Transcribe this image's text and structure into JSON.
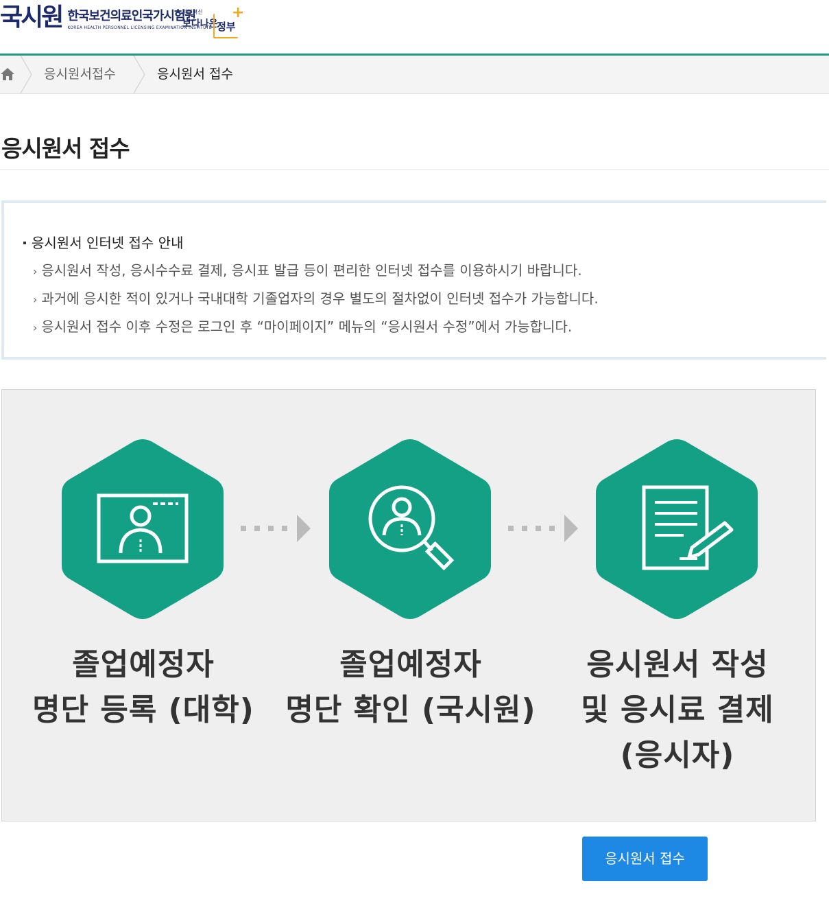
{
  "header": {
    "logo_mark": "국시원",
    "logo_name_ko": "한국보건의료인국가시험원",
    "logo_name_en": "KOREA HEALTH PERSONNEL LICENSING EXAMINATION INSTITUTE",
    "gov_small": "정부혁신",
    "gov_big": "보다나은",
    "gov_word": "정부"
  },
  "breadcrumb": {
    "items": [
      "응시원서접수",
      "응시원서 접수"
    ]
  },
  "page_title": "응시원서 접수",
  "notice": {
    "heading": "응시원서 인터넷 접수 안내",
    "items": [
      "응시원서 작성, 응시수수료 결제, 응시표 발급 등이 편리한 인터넷 접수를 이용하시기 바랍니다.",
      "과거에 응시한 적이 있거나 국내대학 기졸업자의 경우 별도의 절차없이 인터넷 접수가 가능합니다.",
      "응시원서 접수 이후 수정은 로그인 후 “마이페이지” 메뉴의 “응시원서 수정”에서 가능합니다."
    ]
  },
  "process": {
    "steps": [
      {
        "icon": "screen-person-icon",
        "line1": "졸업예정자",
        "line2": "명단 등록 (대학)",
        "line3": ""
      },
      {
        "icon": "magnifier-person-icon",
        "line1": "졸업예정자",
        "line2": "명단 확인 (국시원)",
        "line3": ""
      },
      {
        "icon": "document-pen-icon",
        "line1": "응시원서 작성",
        "line2": "및 응시료 결제",
        "line3": "(응시자)"
      }
    ]
  },
  "colors": {
    "accent": "#1a9a80",
    "hex_fill": "#13a085",
    "button": "#1e88e5",
    "notice_border": "#dfe9f3",
    "process_bg": "#efefef"
  },
  "apply_button": "응시원서 접수"
}
